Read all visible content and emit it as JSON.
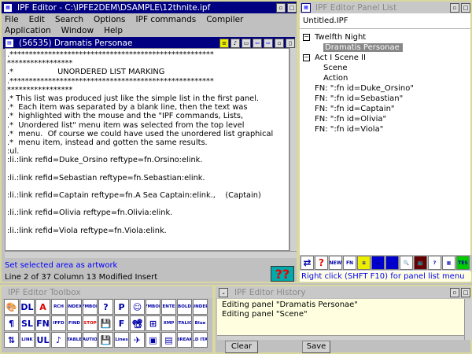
{
  "main_window": {
    "title": "IPF Editor - C:\\IPFE2DEM\\DSAMPLE\\12thnite.ipf",
    "menu": [
      "File",
      "Edit",
      "Search",
      "Options",
      "IPF commands",
      "Compiler",
      "Application",
      "Window",
      "Help"
    ],
    "panel_title": "(56535) Dramatis Personae",
    "lines": [
      ".*****************************************************",
      "*****************",
      ".*                  UNORDERED LIST MARKING",
      ".*****************************************************",
      "*****************",
      ".* This list was produced just like the simple list in the first panel.",
      ".*  Each item was separated by a blank line, then the text was",
      ".*  highlighted with the mouse and the \"IPF commands, Lists,",
      ".*  Unordered list\" menu item was selected from the top level",
      ".*  menu.  Of course we could have used the unordered list graphical",
      ".*  menu item, instead and gotten the same results.",
      ":ul.",
      ":li.:link refid=Duke_Orsino reftype=fn.Orsino:elink.",
      "",
      ":li.:link refid=Sebastian reftype=fn.Sebastian:elink.",
      "",
      ":li.:link refid=Captain reftype=fn.A Sea Captain:elink.,    (Captain)",
      "",
      ":li.:link refid=Olivia reftype=fn.Olivia:elink.",
      "",
      ":li.:link refid=Viola reftype=fn.Viola:elink."
    ],
    "hint": "Set selected area as artwork",
    "status": "Line 2 of 37  Column 13  Modified  Insert"
  },
  "panel_list": {
    "title": "IPF Editor Panel List",
    "file": "Untitled.IPF",
    "tree": [
      {
        "label": "Twelfth Night",
        "level": 0,
        "expander": "−"
      },
      {
        "label": "Dramatis Personae",
        "level": 1,
        "selected": true
      },
      {
        "label": "Act I   Scene II",
        "level": 0,
        "expander": "−"
      },
      {
        "label": "Scene",
        "level": 1
      },
      {
        "label": "Action",
        "level": 1
      },
      {
        "label": "FN: \":fn id=Duke_Orsino\"",
        "level": 2
      },
      {
        "label": "FN: \":fn id=Sebastian\"",
        "level": 2
      },
      {
        "label": "FN: \":fn id=Captain\"",
        "level": 2
      },
      {
        "label": "FN: \":fn id=Olivia\"",
        "level": 2
      },
      {
        "label": "FN: \":fn id=Viola\"",
        "level": 2
      }
    ],
    "toolbar": [
      "⇄",
      "?",
      "NEW",
      "FN",
      "≡",
      "▬",
      "▭",
      "🔍",
      "📺",
      "?",
      "▦",
      "TES"
    ],
    "hint": "Right click (SHFT F10) for panel list menu"
  },
  "toolbox": {
    "title": "IPF Editor Toolbox",
    "icons": [
      [
        "🎨",
        "DL",
        "A",
        "RCH",
        "INDEX",
        "SYMBOLS",
        "?",
        "P",
        "☺",
        "SYMBOLS",
        "CENTER",
        "BOLD",
        "UNDER"
      ],
      [
        "¶",
        "SL",
        "FN",
        "IPFD",
        "FIND",
        "STOP",
        "💾",
        "F",
        "📽",
        "⊞",
        "XMP",
        "ITALIC",
        "Blue"
      ],
      [
        "⇅",
        "LINK",
        "UL",
        "♪",
        "TABLE",
        "CAUTION",
        "💾",
        "Lines",
        "✈",
        "▣",
        "▤",
        "BREAK",
        "BOLD ITALIC"
      ]
    ]
  },
  "history": {
    "title": "IPF Editor History",
    "entries": [
      "Editing panel \"Dramatis Personae\"",
      "Editing panel \"Scene\""
    ],
    "clear_label": "Clear",
    "save_label": "Save"
  },
  "colors": {
    "title_active": "#000080",
    "hint_text": "#0000ff",
    "history_bg": "#ffffe0"
  }
}
